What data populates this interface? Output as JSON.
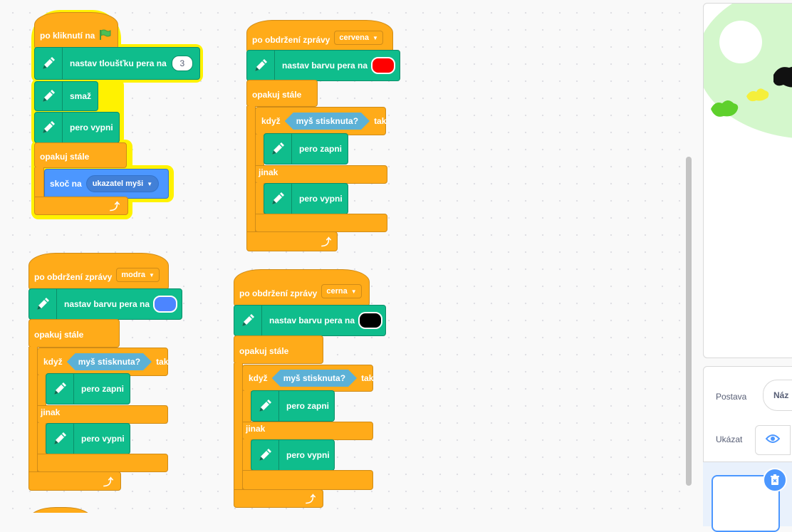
{
  "blocks": {
    "flag_script": {
      "hat": "po kliknutí na",
      "pen_size_label": "nastav tloušťku pera na",
      "pen_size_value": "3",
      "clear": "smaž",
      "pen_up": "pero vypni",
      "forever": "opakuj stále",
      "goto_label": "skoč na",
      "goto_target": "ukazatel myši"
    },
    "red_script": {
      "hat": "po obdržení zprávy",
      "message": "cervena",
      "set_color": "nastav barvu pera na",
      "color": "#ff0000",
      "forever": "opakuj stále",
      "if": "když",
      "condition": "myš stisknuta?",
      "then": "tak",
      "pen_down": "pero zapni",
      "else": "jinak",
      "pen_up": "pero vypni"
    },
    "blue_script": {
      "hat": "po obdržení zprávy",
      "message": "modra",
      "set_color": "nastav barvu pera na",
      "color": "#4c85ff",
      "forever": "opakuj stále",
      "if": "když",
      "condition": "myš stisknuta?",
      "then": "tak",
      "pen_down": "pero zapni",
      "else": "jinak",
      "pen_up": "pero vypni"
    },
    "black_script": {
      "hat": "po obdržení zprávy",
      "message": "cerna",
      "set_color": "nastav barvu pera na",
      "color": "#000000",
      "forever": "opakuj stále",
      "if": "když",
      "condition": "myš stisknuta?",
      "then": "tak",
      "pen_down": "pero zapni",
      "else": "jinak",
      "pen_up": "pero vypni"
    }
  },
  "sprite_info": {
    "sprite_label": "Postava",
    "name_value": "Náz",
    "show_label": "Ukázat"
  },
  "icons": {
    "flag": "green-flag-icon",
    "pen": "pen-icon",
    "loop": "loop-arrow-icon",
    "eye": "eye-icon",
    "trash": "trash-icon"
  },
  "colors": {
    "events": "#ffab19",
    "pen": "#0fbd8c",
    "motion": "#4c97ff",
    "sensing": "#5cb1d6",
    "highlight": "#fff200"
  }
}
